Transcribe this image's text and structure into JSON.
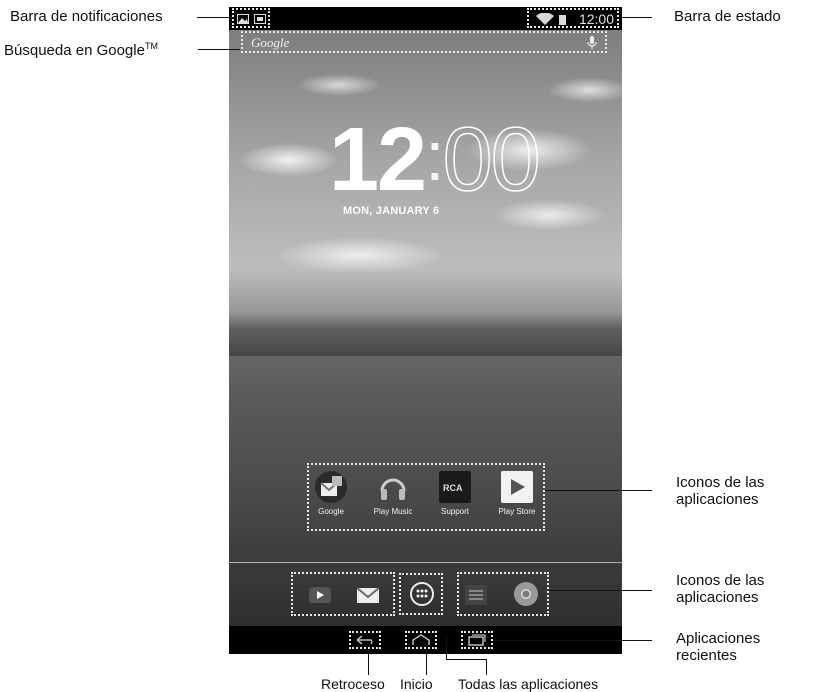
{
  "callouts": {
    "notification_bar": "Barra de notificaciones",
    "google_search": "Búsqueda en Google",
    "google_search_tm": "TM",
    "status_bar": "Barra de estado",
    "app_icons_1_line1": "Iconos de las",
    "app_icons_1_line2": "aplicaciones",
    "app_icons_2_line1": "Iconos de las",
    "app_icons_2_line2": "aplicaciones",
    "recent_apps_line1": "Aplicaciones",
    "recent_apps_line2": "recientes",
    "back": "Retroceso",
    "home": "Inicio",
    "all_apps": "Todas las aplicaciones"
  },
  "screen": {
    "status_time": "12:00",
    "search_placeholder": "Google",
    "clock_hour": "12",
    "clock_colon": ":",
    "clock_minutes": "00",
    "date": "MON, JANUARY 6",
    "apps": [
      {
        "label": "Google",
        "icon": "google-folder-icon"
      },
      {
        "label": "Play Music",
        "icon": "headphones-icon"
      },
      {
        "label": "Support",
        "icon": "rca-icon"
      },
      {
        "label": "Play Store",
        "icon": "play-store-icon"
      }
    ],
    "dock": [
      {
        "icon": "youtube-icon"
      },
      {
        "icon": "gmail-icon"
      },
      {
        "icon": "all-apps-icon"
      },
      {
        "icon": "settings-icon"
      },
      {
        "icon": "chrome-icon"
      }
    ],
    "navigation": [
      {
        "icon": "back-icon"
      },
      {
        "icon": "home-icon"
      },
      {
        "icon": "recent-apps-icon"
      }
    ]
  }
}
